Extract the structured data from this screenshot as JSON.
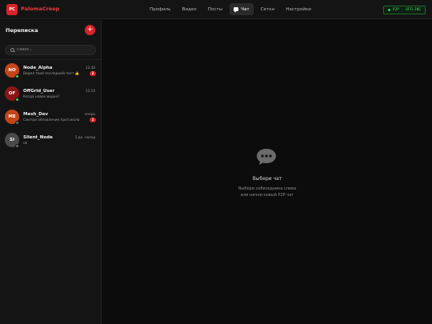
{
  "header": {
    "logo_text": "PC",
    "brand": "PalomaCreep",
    "nav": [
      {
        "label": "Профиль"
      },
      {
        "label": "Видео"
      },
      {
        "label": "Посты"
      },
      {
        "label": "Чат"
      },
      {
        "label": "Сеткн"
      },
      {
        "label": "Настройки"
      }
    ],
    "active_nav": "Чат",
    "status": "P2P · OFFLINE",
    "status_color": "#37d457"
  },
  "sidebar": {
    "title": "Переписка",
    "add_label": "+",
    "search_placeholder": "Поиск...",
    "chats": [
      {
        "initials": "NO",
        "name": "Node_Alpha",
        "time": "12:30",
        "preview": "Видел твой последний пост 👍",
        "unread": "2",
        "avatar_color": "#c4451a",
        "online": true
      },
      {
        "initials": "OF",
        "name": "OffGrid_User",
        "time": "12:16",
        "preview": "Когда новое видео?",
        "unread": "",
        "avatar_color": "#8a1616",
        "online": true
      },
      {
        "initials": "ME",
        "name": "Mesh_Dev",
        "time": "вчера",
        "preview": "Смотри обновление протокола",
        "unread": "1",
        "avatar_color": "#c4451a",
        "online": false
      },
      {
        "initials": "SI",
        "name": "Silent_Node",
        "time": "2 дн. назад",
        "preview": "ok",
        "unread": "",
        "avatar_color": "#4a4a4a",
        "online": false
      }
    ]
  },
  "main": {
    "empty_icon": "chat-bubble-icon",
    "empty_title": "Выбери чат",
    "empty_hint_line1": "Выбери собеседника слева",
    "empty_hint_line2": "или начни новый P2P чат"
  },
  "colors": {
    "accent": "#d9222a",
    "background": "#0c0c0c",
    "panel": "#141414"
  }
}
